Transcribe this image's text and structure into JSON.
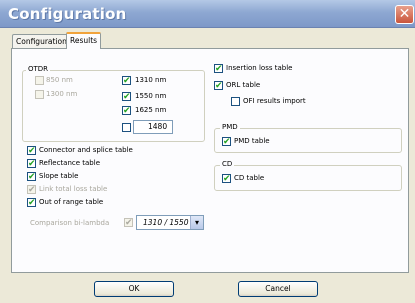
{
  "window": {
    "title": "Configuration",
    "close_glyph": "✕"
  },
  "tabs": [
    {
      "label": "Configuration",
      "active": false
    },
    {
      "label": "Results",
      "active": true
    }
  ],
  "otdr": {
    "title": "OTDR",
    "wavelengths": [
      {
        "label": "850 nm",
        "checked": false,
        "disabled": true
      },
      {
        "label": "1300 nm",
        "checked": false,
        "disabled": true
      },
      {
        "label": "1310 nm",
        "checked": true,
        "disabled": false
      },
      {
        "label": "1550 nm",
        "checked": true,
        "disabled": false
      },
      {
        "label": "1625 nm",
        "checked": true,
        "disabled": false
      }
    ],
    "custom_wavelength": {
      "checked": false,
      "value": "1480"
    }
  },
  "left_options": [
    {
      "label": "Connector and splice table",
      "checked": true,
      "disabled": false
    },
    {
      "label": "Reflectance table",
      "checked": true,
      "disabled": false
    },
    {
      "label": "Slope table",
      "checked": true,
      "disabled": false
    },
    {
      "label": "Link total loss table",
      "checked": true,
      "disabled": true
    },
    {
      "label": "Out of range table",
      "checked": true,
      "disabled": false
    }
  ],
  "bi_lambda": {
    "label": "Comparison bi-lambda",
    "checked": true,
    "disabled": true,
    "selected": "1310 / 1550"
  },
  "right_options": {
    "insertion_loss": {
      "label": "Insertion loss table",
      "checked": true
    },
    "orl": {
      "label": "ORL table",
      "checked": true
    },
    "ofi_import": {
      "label": "OFI results import",
      "checked": false
    }
  },
  "pmd": {
    "title": "PMD",
    "table": {
      "label": "PMD table",
      "checked": true
    }
  },
  "cd": {
    "title": "CD",
    "table": {
      "label": "CD table",
      "checked": true
    }
  },
  "buttons": {
    "ok": "OK",
    "cancel": "Cancel"
  },
  "check_glyph": "✔"
}
